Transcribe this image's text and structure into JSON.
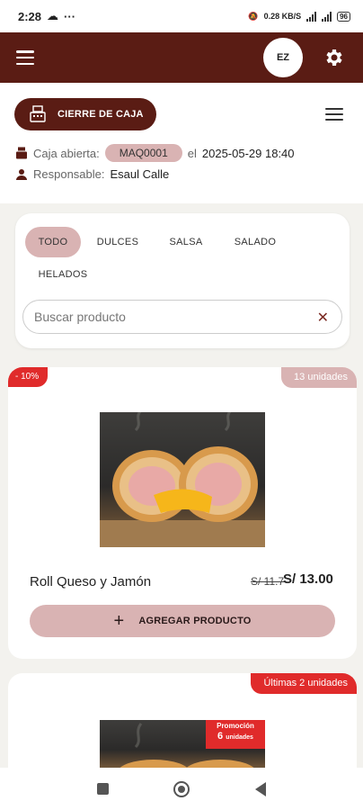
{
  "status_bar": {
    "time": "2:28",
    "network_speed": "0.28 KB/S",
    "battery": "96"
  },
  "app_bar": {
    "avatar_initials": "EZ"
  },
  "header": {
    "cierre_label": "CIERRE DE CAJA",
    "caja_label": "Caja abierta:",
    "caja_code": "MAQ0001",
    "caja_el": "el",
    "caja_datetime": "2025-05-29 18:40",
    "responsable_label": "Responsable:",
    "responsable_name": "Esaul Calle"
  },
  "filters": {
    "tabs": [
      "TODO",
      "DULCES",
      "SALSA",
      "SALADO",
      "HELADOS"
    ],
    "active_tab": "TODO",
    "search_placeholder": "Buscar producto"
  },
  "products": [
    {
      "discount_badge": "- 10%",
      "stock_badge": "13 unidades",
      "name": "Roll Queso y Jamón",
      "old_price": "S/ 11.7",
      "price": "S/ 13.00",
      "add_label": "AGREGAR PRODUCTO",
      "colors": {
        "stock_badge": "#d9b3b3"
      }
    },
    {
      "stock_badge": "Últimas 2 unidades",
      "promo_title": "Promoción",
      "promo_qty": "6",
      "promo_unit": "unidades",
      "colors": {
        "stock_badge": "#e02b2b"
      }
    }
  ],
  "colors": {
    "brand": "#5a1c14",
    "accent_soft": "#d9b3b3",
    "alert": "#e02b2b"
  }
}
